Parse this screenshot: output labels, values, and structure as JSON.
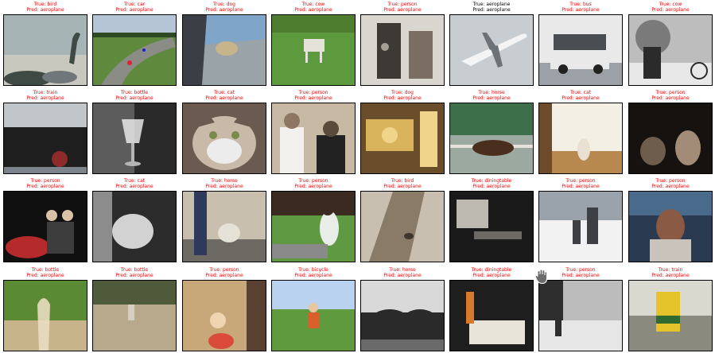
{
  "figure": {
    "items": [
      {
        "true_text": "True: bird",
        "pred_text": "Pred: aeroplane",
        "correct": false,
        "palette": [
          "#a7b4b5",
          "#6f777a",
          "#3f4a45",
          "#c9c8bf"
        ],
        "subject": "bird-on-rocks"
      },
      {
        "true_text": "True: car",
        "pred_text": "Pred: aeroplane",
        "correct": false,
        "palette": [
          "#5f8a3e",
          "#8c8c86",
          "#b6c5d6",
          "#2f4a23"
        ],
        "subject": "race-track"
      },
      {
        "true_text": "True: dog",
        "pred_text": "Pred: aeroplane",
        "correct": false,
        "palette": [
          "#7fa6c8",
          "#3b3f45",
          "#9aa3a8",
          "#c8b48a"
        ],
        "subject": "dog-in-car"
      },
      {
        "true_text": "True: cow",
        "pred_text": "Pred: aeroplane",
        "correct": false,
        "palette": [
          "#5d9a3e",
          "#e4e2d8",
          "#4f7d30",
          "#a8c48a"
        ],
        "subject": "cow-field"
      },
      {
        "true_text": "True: person",
        "pred_text": "Pred: aeroplane",
        "correct": false,
        "palette": [
          "#d9d6d0",
          "#7a6e62",
          "#a79f96",
          "#3d3a36"
        ],
        "subject": "doorway"
      },
      {
        "true_text": "True: aeroplane",
        "pred_text": "Pred: aeroplane",
        "correct": true,
        "palette": [
          "#c8cdd1",
          "#f4f4f4",
          "#6c7378",
          "#dfe3e6"
        ],
        "subject": "airliner"
      },
      {
        "true_text": "True: bus",
        "pred_text": "Pred: aeroplane",
        "correct": false,
        "palette": [
          "#e9e9e9",
          "#4a4e52",
          "#9ba1a6",
          "#c9c3b8"
        ],
        "subject": "bus"
      },
      {
        "true_text": "True: cow",
        "pred_text": "Pred: aeroplane",
        "correct": false,
        "palette": [
          "#bdbdbd",
          "#2b2b2b",
          "#7a7a7a",
          "#e8e8e8"
        ],
        "subject": "bw-street"
      },
      {
        "true_text": "True: train",
        "pred_text": "Pred: aeroplane",
        "correct": false,
        "palette": [
          "#1e1e1e",
          "#7d838a",
          "#c1c6cb",
          "#8e2a2a"
        ],
        "subject": "locomotive"
      },
      {
        "true_text": "True: bottle",
        "pred_text": "Pred: aeroplane",
        "correct": false,
        "palette": [
          "#2a2a2a",
          "#b5b5b5",
          "#5c5c5c",
          "#e6e6e6"
        ],
        "subject": "glass"
      },
      {
        "true_text": "True: cat",
        "pred_text": "Pred: aeroplane",
        "correct": false,
        "palette": [
          "#6a5a4f",
          "#ececec",
          "#3b302a",
          "#c8b9a8"
        ],
        "subject": "cat-face"
      },
      {
        "true_text": "True: person",
        "pred_text": "Pred: aeroplane",
        "correct": false,
        "palette": [
          "#c8b9a5",
          "#f2f0ec",
          "#5a4a3c",
          "#8d7662"
        ],
        "subject": "two-people"
      },
      {
        "true_text": "True: dog",
        "pred_text": "Pred: aeroplane",
        "correct": false,
        "palette": [
          "#d9b35b",
          "#6a4d2a",
          "#2f2415",
          "#f0d48a"
        ],
        "subject": "dogs-train"
      },
      {
        "true_text": "True: horse",
        "pred_text": "Pred: aeroplane",
        "correct": false,
        "palette": [
          "#3d6f4a",
          "#e7e3dc",
          "#4a2f1f",
          "#9ca9a0"
        ],
        "subject": "horse-jump"
      },
      {
        "true_text": "True: cat",
        "pred_text": "Pred: aeroplane",
        "correct": false,
        "palette": [
          "#b7894f",
          "#e8e1d3",
          "#6e4b2a",
          "#f3efe4"
        ],
        "subject": "cat-floor"
      },
      {
        "true_text": "True: person",
        "pred_text": "Pred: aeroplane",
        "correct": false,
        "palette": [
          "#2a2420",
          "#6e5c4c",
          "#a28c77",
          "#16120f"
        ],
        "subject": "dark-room"
      },
      {
        "true_text": "True: person",
        "pred_text": "Pred: aeroplane",
        "correct": false,
        "palette": [
          "#101010",
          "#b52a2a",
          "#d9c2a8",
          "#3d3d3d"
        ],
        "subject": "motorbike-night"
      },
      {
        "true_text": "True: cat",
        "pred_text": "Pred: aeroplane",
        "correct": false,
        "palette": [
          "#2c2c2c",
          "#8c8c8c",
          "#d2d2d2",
          "#4e4e4e"
        ],
        "subject": "cat-lap"
      },
      {
        "true_text": "True: horse",
        "pred_text": "Pred: aeroplane",
        "correct": false,
        "palette": [
          "#c9bfae",
          "#2f3a5a",
          "#6d6a63",
          "#e6e1d6"
        ],
        "subject": "person-goat"
      },
      {
        "true_text": "True: person",
        "pred_text": "Pred: aeroplane",
        "correct": false,
        "palette": [
          "#5f9a43",
          "#e9ede8",
          "#3b2a1f",
          "#9bbd85"
        ],
        "subject": "woman-lawn"
      },
      {
        "true_text": "True: bird",
        "pred_text": "Pred: aeroplane",
        "correct": false,
        "palette": [
          "#8a7b68",
          "#3f362c",
          "#c9bfb0",
          "#5e5244"
        ],
        "subject": "bird-tree"
      },
      {
        "true_text": "True: diningtable",
        "pred_text": "Pred: aeroplane",
        "correct": false,
        "palette": [
          "#1a1a1a",
          "#6d6a66",
          "#bdb8b0",
          "#3a3835"
        ],
        "subject": "dining-room"
      },
      {
        "true_text": "True: person",
        "pred_text": "Pred: aeroplane",
        "correct": false,
        "palette": [
          "#f2f2f2",
          "#9aa2ab",
          "#3d3f44",
          "#d8dde3"
        ],
        "subject": "snow"
      },
      {
        "true_text": "True: person",
        "pred_text": "Pred: aeroplane",
        "correct": false,
        "palette": [
          "#4a6a8c",
          "#8a5a45",
          "#c9c3bb",
          "#2a3a50"
        ],
        "subject": "woman-smile"
      },
      {
        "true_text": "True: bottle",
        "pred_text": "Pred: aeroplane",
        "correct": false,
        "palette": [
          "#5b8a35",
          "#c8b48a",
          "#3a5a22",
          "#e9dcc0"
        ],
        "subject": "bottle-field"
      },
      {
        "true_text": "True: bottle",
        "pred_text": "Pred: aeroplane",
        "correct": false,
        "palette": [
          "#7a7a5e",
          "#b9a98c",
          "#4e5a3a",
          "#d6d0c3"
        ],
        "subject": "yard"
      },
      {
        "true_text": "True: person",
        "pred_text": "Pred: aeroplane",
        "correct": false,
        "palette": [
          "#c8a878",
          "#3a5a8c",
          "#d94a3a",
          "#5a4030"
        ],
        "subject": "kid-toy"
      },
      {
        "true_text": "True: bicycle",
        "pred_text": "Pred: aeroplane",
        "correct": false,
        "palette": [
          "#5f9a3e",
          "#b8d2ef",
          "#d9602a",
          "#3d6f2a"
        ],
        "subject": "cyclist"
      },
      {
        "true_text": "True: horse",
        "pred_text": "Pred: aeroplane",
        "correct": false,
        "palette": [
          "#2a2a2a",
          "#a9a9a9",
          "#6a6a6a",
          "#d9d9d9"
        ],
        "subject": "horses-dark"
      },
      {
        "true_text": "True: diningtable",
        "pred_text": "Pred: aeroplane",
        "correct": false,
        "palette": [
          "#1e1e1e",
          "#e9e4da",
          "#d97a2a",
          "#5a5046"
        ],
        "subject": "table-food"
      },
      {
        "true_text": "True: person",
        "pred_text": "Pred: aeroplane",
        "correct": false,
        "palette": [
          "#bcbcbc",
          "#2e2e2e",
          "#7a7a7a",
          "#e6e6e6"
        ],
        "subject": "bw-fence"
      },
      {
        "true_text": "True: train",
        "pred_text": "Pred: aeroplane",
        "correct": false,
        "palette": [
          "#d9d9cf",
          "#e4c42a",
          "#2f6a2f",
          "#8a8a7e"
        ],
        "subject": "yellow-train"
      }
    ],
    "cursor_icon": "hand-grab-icon"
  }
}
